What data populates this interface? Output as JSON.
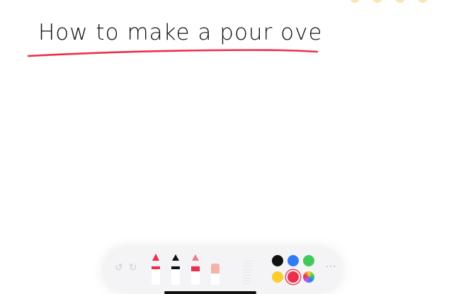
{
  "note": {
    "title": "How to make a pour over",
    "underline_color": "#ee2e4a"
  },
  "toolbar": {
    "undo_icon": "undo-icon",
    "redo_icon": "redo-icon",
    "tools": [
      {
        "name": "pen",
        "color": "#ee2e4a"
      },
      {
        "name": "marker",
        "color": "#111111"
      },
      {
        "name": "highlighter",
        "color": "#ee2e4a"
      },
      {
        "name": "eraser",
        "color": "#f2b3a9"
      },
      {
        "name": "ruler",
        "color": "#dcdce0"
      }
    ],
    "colors": [
      "#111111",
      "#2f7cf6",
      "#41c95a",
      "#f8cf2b",
      "#ee2e4a",
      "multicolor"
    ],
    "selected_color": "#ee2e4a",
    "more_label": "···"
  }
}
